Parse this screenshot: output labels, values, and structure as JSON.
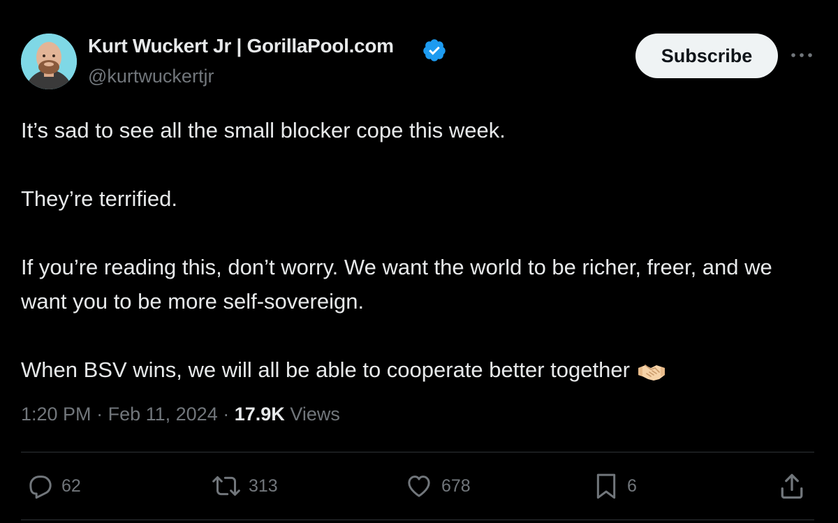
{
  "author": {
    "name": "Kurt Wuckert Jr | GorillaPool.com",
    "handle": "@kurtwuckertjr",
    "verified": true,
    "avatar_icon": "avatar-photo"
  },
  "header": {
    "subscribe_label": "Subscribe",
    "more_icon": "more-horizontal-icon"
  },
  "tweet": {
    "paragraphs": [
      "It’s sad to see all the small blocker cope this week.",
      "They’re terrified.",
      "If you’re reading this, don’t worry. We want the world to be richer, freer, and we want you to be more self-sovereign.",
      "When BSV wins, we will all be able to cooperate better together"
    ],
    "emoji": "handshake-icon"
  },
  "meta": {
    "time": "1:20 PM",
    "separator": "·",
    "date": "Feb 11, 2024",
    "views_count": "17.9K",
    "views_label": "Views"
  },
  "actions": {
    "replies": "62",
    "reposts": "313",
    "likes": "678",
    "bookmarks": "6"
  },
  "colors": {
    "background": "#000000",
    "text_primary": "#e7e9ea",
    "text_secondary": "#71767b",
    "verified_blue": "#1d9bf0",
    "button_bg": "#eff3f4",
    "divider": "#2f3336"
  }
}
